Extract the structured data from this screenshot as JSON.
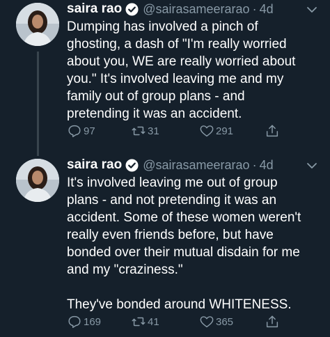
{
  "tweets": [
    {
      "author_name": "saira rao",
      "handle": "@sairasameerarao",
      "separator": "·",
      "time": "4d",
      "text": "Dumping has involved a pinch of\nghosting, a dash of \"I'm really worried\nabout you, WE are really worried about\nyou.\" It's involved leaving me and my\nfamily out of group plans - and\npretending it was an accident.",
      "replies": "97",
      "retweets": "31",
      "likes": "291"
    },
    {
      "author_name": "saira rao",
      "handle": "@sairasameerarao",
      "separator": "·",
      "time": "4d",
      "text": "It's involved leaving me out of group\nplans - and not pretending it was an\naccident. Some of these women weren't\nreally even friends before, but have\nbonded over their mutual disdain for me\nand my \"craziness.\"\n\nThey've bonded around WHITENESS.",
      "replies": "169",
      "retweets": "41",
      "likes": "365"
    }
  ],
  "icons": {
    "verified": "verified-badge-icon",
    "caret": "chevron-down-icon",
    "reply": "reply-icon",
    "retweet": "retweet-icon",
    "like": "heart-icon",
    "share": "share-icon"
  },
  "colors": {
    "background": "#15202b",
    "text": "#ffffff",
    "muted": "#8899a6",
    "thread_line": "#38444d"
  }
}
